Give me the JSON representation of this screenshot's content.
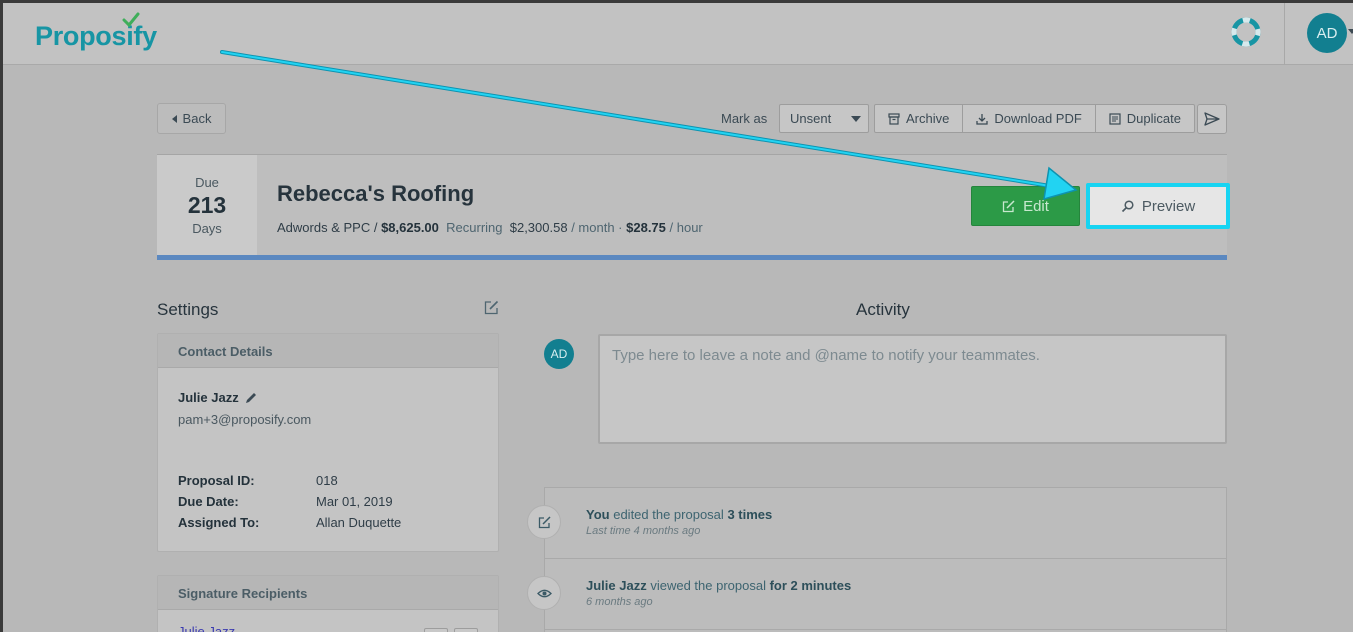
{
  "brand": {
    "name": "Proposify",
    "accent": "#1795a4"
  },
  "user": {
    "initials": "AD"
  },
  "toolbar": {
    "back_label": "Back",
    "mark_as_label": "Mark as",
    "status_value": "Unsent",
    "archive_label": "Archive",
    "download_label": "Download PDF",
    "duplicate_label": "Duplicate"
  },
  "proposal": {
    "due_label": "Due",
    "due_number": "213",
    "due_unit": "Days",
    "title": "Rebecca's Roofing",
    "service": "Adwords & PPC /",
    "amount": "$8,625.00",
    "recurring_label": "Recurring",
    "recurring_amount": "$2,300.58",
    "recurring_unit": "/ month ·",
    "hourly_amount": "$28.75",
    "hourly_unit": "/ hour",
    "edit_label": "Edit",
    "preview_label": "Preview"
  },
  "settings": {
    "title": "Settings",
    "contact": {
      "heading": "Contact Details",
      "name": "Julie Jazz",
      "email": "pam+3@proposify.com",
      "fields": [
        {
          "label": "Proposal ID:",
          "value": "018"
        },
        {
          "label": "Due Date:",
          "value": "Mar 01, 2019"
        },
        {
          "label": "Assigned To:",
          "value": "Allan Duquette"
        }
      ]
    },
    "signature": {
      "heading": "Signature Recipients",
      "recipient": "Julie Jazz"
    }
  },
  "activity": {
    "title": "Activity",
    "note_placeholder": "Type here to leave a note and @name to notify your teammates.",
    "items": [
      {
        "actor": "You",
        "action": "edited the proposal",
        "detail": "3 times",
        "time": "Last time 4 months ago"
      },
      {
        "actor": "Julie Jazz",
        "action": "viewed the proposal",
        "detail": "for 2 minutes",
        "time": "6 months ago"
      }
    ]
  },
  "colors": {
    "edit_green": "#2c9a47",
    "highlight_cyan": "#17d4f2",
    "progress_blue": "#5b88c0"
  }
}
